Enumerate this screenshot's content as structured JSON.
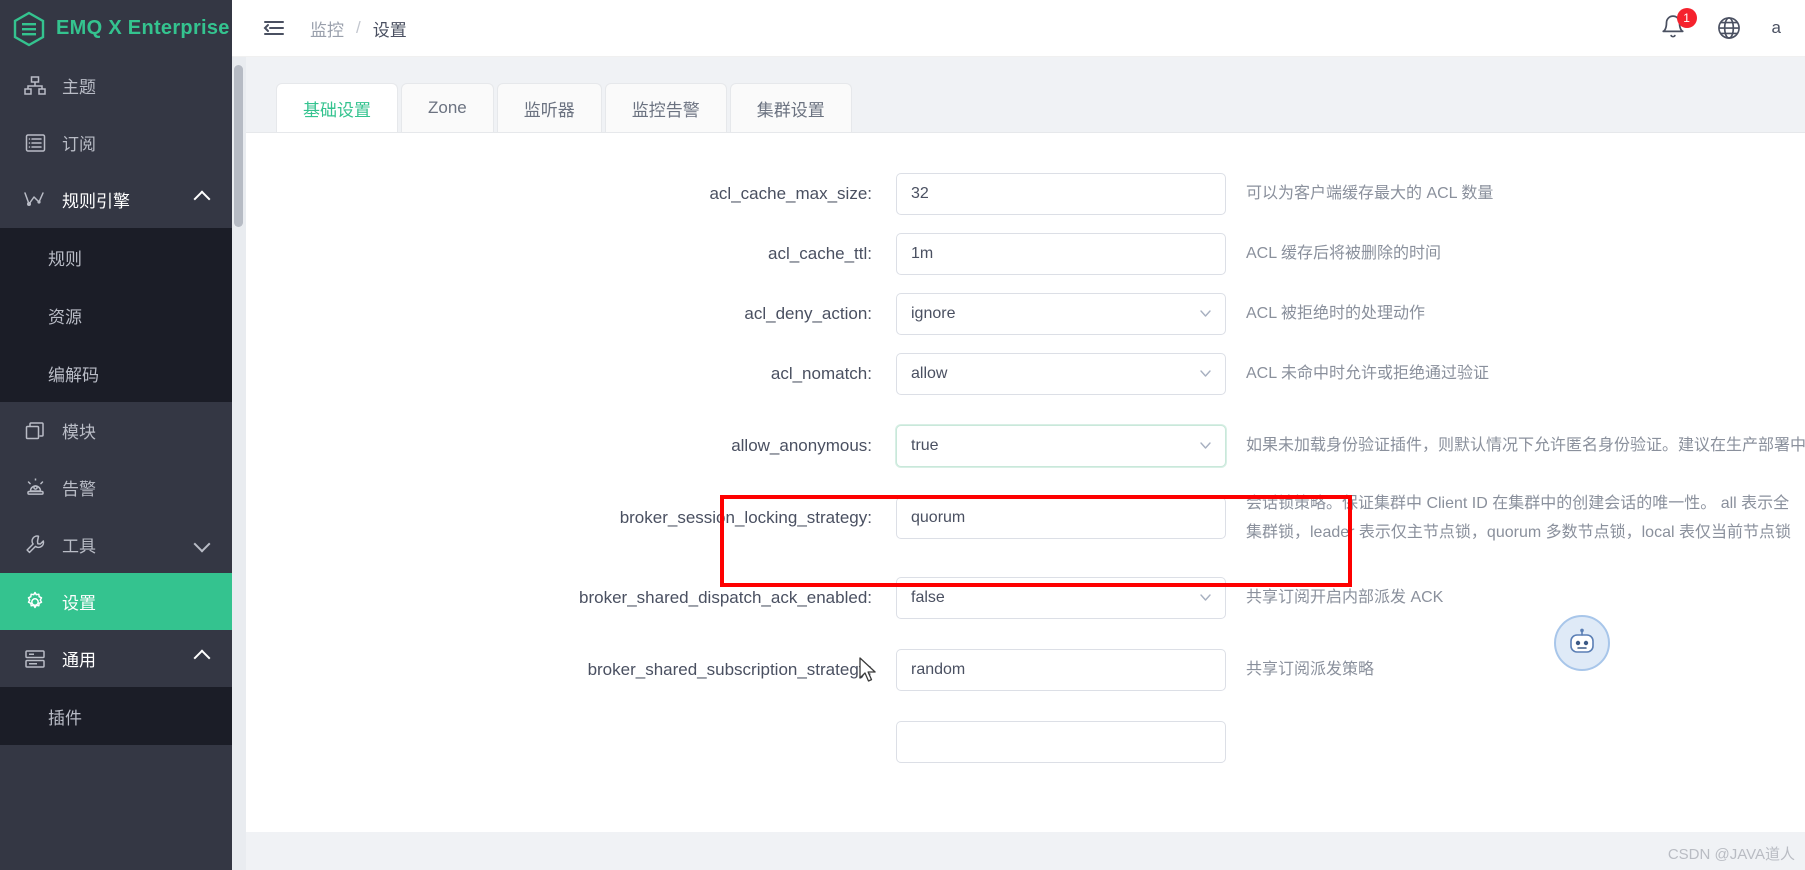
{
  "brand": {
    "name": "EMQ X Enterprise",
    "logo_icon": "emq-hexagon-logo"
  },
  "sidebar": {
    "items": [
      {
        "label": "主题",
        "icon": "topic-tree-icon",
        "state": "normal"
      },
      {
        "label": "订阅",
        "icon": "subscription-list-icon",
        "state": "normal"
      },
      {
        "label": "规则引擎",
        "icon": "rule-engine-icon",
        "state": "expanded",
        "caret": "chevron-up-icon"
      },
      {
        "label": "模块",
        "icon": "module-copy-icon",
        "state": "normal"
      },
      {
        "label": "告警",
        "icon": "alarm-siren-icon",
        "state": "normal"
      },
      {
        "label": "工具",
        "icon": "wrench-tool-icon",
        "state": "collapsed",
        "caret": "chevron-down-icon"
      },
      {
        "label": "设置",
        "icon": "gear-settings-icon",
        "state": "active"
      },
      {
        "label": "通用",
        "icon": "general-server-icon",
        "state": "expanded",
        "caret": "chevron-up-icon"
      }
    ],
    "rule_engine_children": [
      "规则",
      "资源",
      "编解码"
    ],
    "general_children": [
      "插件"
    ]
  },
  "topbar": {
    "menu_icon": "hamburger-collapse-icon",
    "breadcrumb": {
      "parent": "监控",
      "separator": "/",
      "current": "设置"
    },
    "bell_icon": "bell-notification-icon",
    "bell_badge": "1",
    "globe_icon": "globe-language-icon",
    "account": "a"
  },
  "tabs": [
    {
      "label": "基础设置",
      "active": true
    },
    {
      "label": "Zone",
      "active": false
    },
    {
      "label": "监听器",
      "active": false
    },
    {
      "label": "监控告警",
      "active": false
    },
    {
      "label": "集群设置",
      "active": false
    }
  ],
  "form": {
    "rows": [
      {
        "label": "acl_cache_max_size:",
        "value": "32",
        "type": "input",
        "desc": "可以为客户端缓存最大的 ACL 数量",
        "focused": false
      },
      {
        "label": "acl_cache_ttl:",
        "value": "1m",
        "type": "input",
        "desc": "ACL 缓存后将被删除的时间",
        "focused": false
      },
      {
        "label": "acl_deny_action:",
        "value": "ignore",
        "type": "select",
        "desc": "ACL 被拒绝时的处理动作",
        "focused": false
      },
      {
        "label": "acl_nomatch:",
        "value": "allow",
        "type": "select",
        "desc": "ACL 未命中时允许或拒绝通过验证",
        "focused": false
      },
      {
        "label": "allow_anonymous:",
        "value": "true",
        "type": "select",
        "desc": "如果未加载身份验证插件，则默认情况下允许匿名身份验证。建议在生产部署中禁用该选项",
        "focused": true
      },
      {
        "label": "broker_session_locking_strategy:",
        "value": "quorum",
        "type": "select",
        "desc": "会话锁策略。保证集群中 Client ID 在集群中的创建会话的唯一性。 all 表示全集群锁，leader 表示仅主节点锁，quorum 多数节点锁，local 表仅当前节点锁",
        "focused": false
      },
      {
        "label": "broker_shared_dispatch_ack_enabled:",
        "value": "false",
        "type": "select",
        "desc": "共享订阅开启内部派发 ACK",
        "focused": false
      },
      {
        "label": "broker_shared_subscription_strategy:",
        "value": "random",
        "type": "select",
        "desc": "共享订阅派发策略",
        "focused": false
      }
    ],
    "highlight_color": "#fe0000",
    "accent_color": "#34c38f"
  },
  "overlay": {
    "robot_icon": "robot-assistant-avatar",
    "cursor_icon": "mouse-pointer-cursor",
    "watermark": "CSDN @JAVA道人"
  }
}
